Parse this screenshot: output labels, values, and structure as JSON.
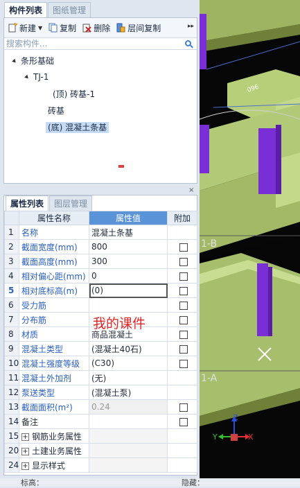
{
  "panel1": {
    "tabs": [
      "构件列表",
      "图纸管理"
    ],
    "toolbar": {
      "new": "新建",
      "copy": "复制",
      "delete": "删除",
      "layer_copy": "层间复制",
      "more": "▸▸"
    },
    "search_placeholder": "搜索构件...",
    "tree": {
      "root": "条形基础",
      "child": "TJ-1",
      "leaves": [
        "(顶) 砖基-1",
        "砖基",
        "(底) 混凝土条基"
      ]
    }
  },
  "panel2": {
    "close": "×",
    "tabs": [
      "属性列表",
      "图层管理"
    ],
    "columns": [
      "属性名称",
      "属性值",
      "附加"
    ],
    "rows": [
      {
        "num": "1",
        "name": "名称",
        "value": "混凝土条基",
        "blue": true,
        "check": false
      },
      {
        "num": "2",
        "name": "截面宽度(mm)",
        "value": "800",
        "blue": true,
        "check": true
      },
      {
        "num": "3",
        "name": "截面高度(mm)",
        "value": "300",
        "blue": true,
        "check": true
      },
      {
        "num": "4",
        "name": "相对偏心距(mm)",
        "value": "0",
        "blue": true,
        "check": true
      },
      {
        "num": "5",
        "name": "相对底标高(m)",
        "value": "(0)",
        "blue": true,
        "check": true
      },
      {
        "num": "6",
        "name": "受力筋",
        "value": "",
        "blue": true,
        "check": true
      },
      {
        "num": "7",
        "name": "分布筋",
        "value": "",
        "blue": true,
        "check": true
      },
      {
        "num": "8",
        "name": "材质",
        "value": "商品混凝土",
        "blue": true,
        "check": true
      },
      {
        "num": "9",
        "name": "混凝土类型",
        "value": "(混凝土40石)",
        "blue": true,
        "check": true
      },
      {
        "num": "10",
        "name": "混凝土强度等级",
        "value": "(C30)",
        "blue": true,
        "check": true
      },
      {
        "num": "11",
        "name": "混凝土外加剂",
        "value": "(无)",
        "blue": true,
        "check": false
      },
      {
        "num": "12",
        "name": "泵送类型",
        "value": "(混凝土泵)",
        "blue": true,
        "check": false
      },
      {
        "num": "13",
        "name": "截面面积(m²)",
        "value": "0.24",
        "blue": true,
        "check": true
      },
      {
        "num": "14",
        "name": "备注",
        "value": "",
        "blue": false,
        "check": true
      }
    ],
    "groups": [
      {
        "num": "15",
        "name": "钢筋业务属性"
      },
      {
        "num": "20",
        "name": "土建业务属性"
      },
      {
        "num": "24",
        "name": "显示样式"
      }
    ]
  },
  "watermark": "我的课件",
  "viewport": {
    "labels": [
      "1-B",
      "1-A"
    ],
    "dim_text": "096",
    "axes": {
      "x": "X",
      "y": "Y",
      "z": "Z"
    }
  },
  "status": {
    "left": "标高：",
    "right": "隐藏："
  },
  "colors": {
    "beam": "#b7cf78",
    "column": "#7a2fd6",
    "selected_row_header": "#5b93d8",
    "label_blue": "#2a5fbf"
  }
}
